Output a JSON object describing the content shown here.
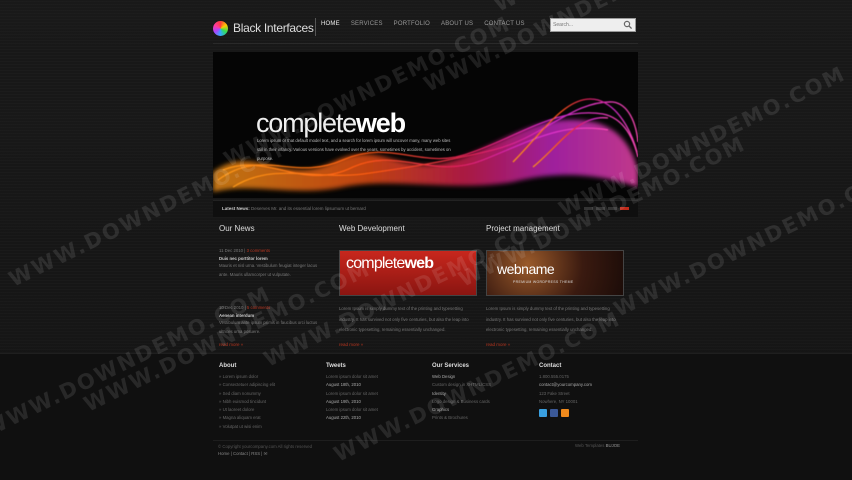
{
  "logo": {
    "text": "Black Interfaces"
  },
  "nav": [
    "HOME",
    "SERVICES",
    "PORTFOLIO",
    "ABOUT US",
    "CONTACT US"
  ],
  "search": {
    "placeholder": "Search..."
  },
  "banner": {
    "title_light": "complete",
    "title_bold": "web",
    "text": "Lorem ipsum or that default model text, and a search for lorem ipsum will uncover many, many web sites still in their infancy. Various versions have evolved over the years, sometimes by accident, sometimes on purpose."
  },
  "ticker": {
    "label": "Latest News:",
    "text": "Deserves Mr. and its essential lorem lipsumum ut bernard"
  },
  "news": {
    "heading": "Our News",
    "items": [
      {
        "date": "11 Dec 2010",
        "comments": "3 comments",
        "title": "Duis nec porttitor lorem",
        "body": "Mauris et nisl urna. Vestibulum feugiat integer lacus ante. Mauris ullamcorper ut vulputate."
      },
      {
        "date": "10 Dec 2010",
        "comments": "5 comments",
        "title": "Aenean interdum",
        "body": "Vestibulum ante ipsum primis in faucibus orci luctus ultrices urna posuere."
      }
    ],
    "more": "read more »"
  },
  "webdev": {
    "heading": "Web Development",
    "image_light": "complete",
    "image_bold": "web",
    "body": "Lorem Ipsum is simply dummy text of the printing and typesetting industry. It has survived not only five centuries, but also the leap into electronic typesetting, remaining essentially unchanged.",
    "more": "read more »"
  },
  "project": {
    "heading": "Project management",
    "image_text": "webname",
    "image_sub": "PREMIUM WORDPRESS THEME",
    "body": "Lorem Ipsum is simply dummy text of the printing and typesetting industry. It has survived not only five centuries, but also the leap into electronic typesetting, remaining essentially unchanged.",
    "more": "read more »"
  },
  "footer": {
    "about": {
      "heading": "About",
      "links": [
        "» Lorem ipsum dolor",
        "» Consectetuer adipiscing elit",
        "» Sed diam nonummy",
        "» Nibh euismod tincidunt",
        "» Ut laoreet dolore",
        "» Magna aliquam erat",
        "» Volutpat ut wisi enim"
      ]
    },
    "tweets": {
      "heading": "Tweets",
      "lines": [
        "Lorem ipsum dolor sit amet",
        "August 18th, 2010",
        "Lorem ipsum dolor sit amet",
        "August 19th, 2010",
        "Lorem ipsum dolor sit amet",
        "August 22th, 2010"
      ]
    },
    "services": {
      "heading": "Our Services",
      "lines": [
        "Web Design",
        "Custom design in XHTML/CSS",
        "Identity",
        "Logo design & Business cards",
        "Graphics",
        "Prints & Brochures"
      ]
    },
    "contact": {
      "heading": "Contact",
      "lines": [
        "1.800.555.0175",
        "contact@yourcompany.com",
        "123 Fake Street",
        "Nowhere, NY 10001"
      ]
    },
    "copyright": "© Copyright yourcompany.com All rights reserved",
    "links": "Home  |  Contact  |  RSS  |  ✉",
    "credit_label": "Web Templates",
    "credit_name": "BUJOE"
  },
  "watermark": "WWW.DOWNDEMO.COM"
}
